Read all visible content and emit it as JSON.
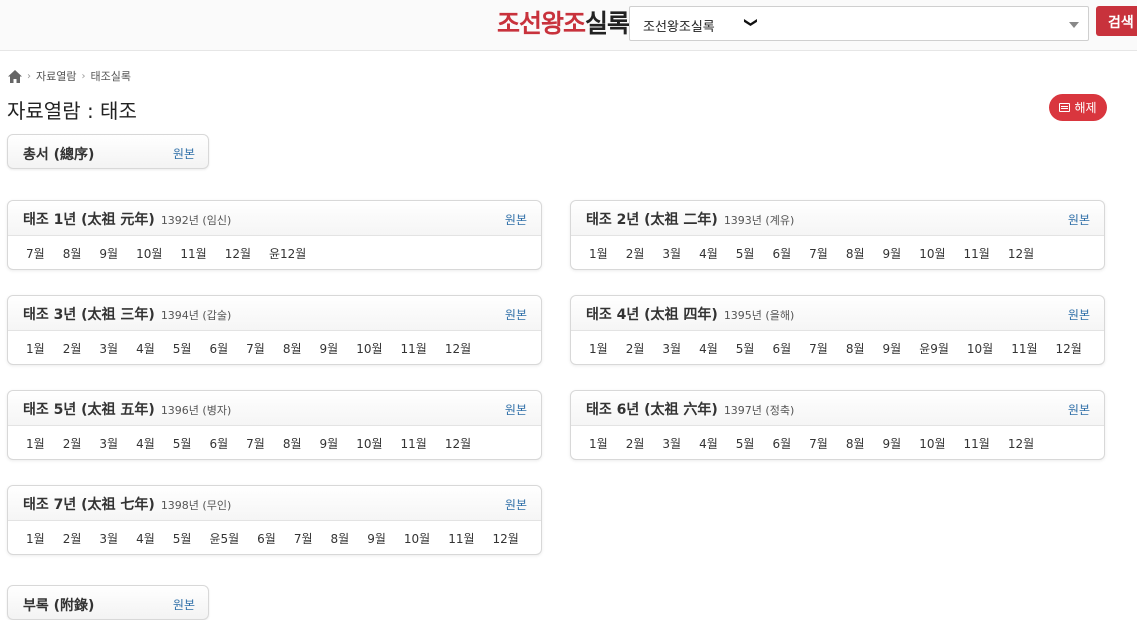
{
  "header": {
    "logo_red": "조선왕조",
    "logo_dark": "실록",
    "select_value": "조선왕조실록",
    "select_chevron": "❯",
    "search_label": "검색"
  },
  "breadcrumb": {
    "items": [
      "자료열람",
      "태조실록"
    ],
    "sep": "›"
  },
  "page_title": "자료열람 : 태조",
  "explain_label": "해제",
  "preface": {
    "title": "총서 (總序)",
    "link": "원본"
  },
  "appendix": {
    "title": "부록 (附錄)",
    "link": "원본"
  },
  "years": [
    {
      "title": "태조 1년 (太祖 元年)",
      "year": "1392년 (임신)",
      "link": "원본",
      "months": [
        "7월",
        "8월",
        "9월",
        "10월",
        "11월",
        "12월",
        "윤12월"
      ]
    },
    {
      "title": "태조 2년 (太祖 二年)",
      "year": "1393년 (계유)",
      "link": "원본",
      "months": [
        "1월",
        "2월",
        "3월",
        "4월",
        "5월",
        "6월",
        "7월",
        "8월",
        "9월",
        "10월",
        "11월",
        "12월"
      ]
    },
    {
      "title": "태조 3년 (太祖 三年)",
      "year": "1394년 (갑술)",
      "link": "원본",
      "months": [
        "1월",
        "2월",
        "3월",
        "4월",
        "5월",
        "6월",
        "7월",
        "8월",
        "9월",
        "10월",
        "11월",
        "12월"
      ]
    },
    {
      "title": "태조 4년 (太祖 四年)",
      "year": "1395년 (을해)",
      "link": "원본",
      "months": [
        "1월",
        "2월",
        "3월",
        "4월",
        "5월",
        "6월",
        "7월",
        "8월",
        "9월",
        "윤9월",
        "10월",
        "11월",
        "12월"
      ]
    },
    {
      "title": "태조 5년 (太祖 五年)",
      "year": "1396년 (병자)",
      "link": "원본",
      "months": [
        "1월",
        "2월",
        "3월",
        "4월",
        "5월",
        "6월",
        "7월",
        "8월",
        "9월",
        "10월",
        "11월",
        "12월"
      ]
    },
    {
      "title": "태조 6년 (太祖 六年)",
      "year": "1397년 (정축)",
      "link": "원본",
      "months": [
        "1월",
        "2월",
        "3월",
        "4월",
        "5월",
        "6월",
        "7월",
        "8월",
        "9월",
        "10월",
        "11월",
        "12월"
      ]
    },
    {
      "title": "태조 7년 (太祖 七年)",
      "year": "1398년 (무인)",
      "link": "원본",
      "months": [
        "1월",
        "2월",
        "3월",
        "4월",
        "5월",
        "윤5월",
        "6월",
        "7월",
        "8월",
        "9월",
        "10월",
        "11월",
        "12월"
      ]
    }
  ],
  "colors": {
    "accent": "#c8323c",
    "link": "#2f6fa8"
  }
}
